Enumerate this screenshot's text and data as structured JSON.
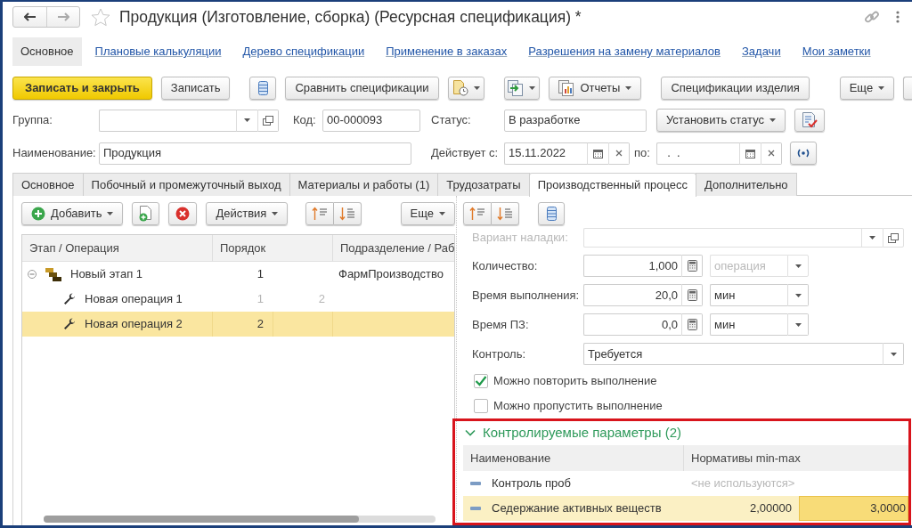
{
  "window": {
    "title": "Продукция (Изготовление, сборка) (Ресурсная спецификация) *"
  },
  "nav_panel": [
    {
      "label": "Основное",
      "selected": true
    },
    {
      "label": "Плановые калькуляции",
      "selected": false
    },
    {
      "label": "Дерево спецификации",
      "selected": false
    },
    {
      "label": "Применение в заказах",
      "selected": false
    },
    {
      "label": "Разрешения на замену материалов",
      "selected": false
    },
    {
      "label": "Задачи",
      "selected": false
    },
    {
      "label": "Мои заметки",
      "selected": false
    }
  ],
  "toolbar": [
    {
      "kind": "primary",
      "label": "Записать и закрыть"
    },
    {
      "kind": "button",
      "label": "Записать"
    },
    {
      "kind": "icon"
    },
    {
      "kind": "button",
      "label": "Сравнить спецификации"
    },
    {
      "kind": "icon-menu"
    },
    {
      "kind": "icon-menu"
    },
    {
      "kind": "icon-menu",
      "label": "Отчеты"
    },
    {
      "kind": "button",
      "label": "Спецификации изделия"
    },
    {
      "kind": "menu",
      "label": "Еще"
    },
    {
      "kind": "stub"
    }
  ],
  "group_field": {
    "label": "Группа:"
  },
  "code_field": {
    "label": "Код:",
    "value": "00-000093"
  },
  "status_field": {
    "label": "Статус:",
    "value": "В разработке"
  },
  "set_status_button": {
    "label": "Установить статус"
  },
  "name_field": {
    "label": "Наименование:",
    "value": "Продукция"
  },
  "valid_from": {
    "label": "Действует с:",
    "value": "15.11.2022"
  },
  "valid_to": {
    "label": "по:",
    "value": "  .  ."
  },
  "tabs": [
    {
      "label": "Основное",
      "selected": false
    },
    {
      "label": "Побочный и промежуточный выход",
      "selected": false
    },
    {
      "label": "Материалы и работы (1)",
      "selected": false
    },
    {
      "label": "Трудозатраты",
      "selected": false
    },
    {
      "label": "Производственный процесс",
      "selected": true
    },
    {
      "label": "Дополнительно",
      "selected": false
    }
  ],
  "stages_toolbar": [
    {
      "kind": "icon-menu",
      "label": "Добавить"
    },
    {
      "kind": "icon"
    },
    {
      "kind": "icon"
    },
    {
      "kind": "menu",
      "label": "Действия"
    },
    {
      "kind": "pair"
    },
    {
      "kind": "menu",
      "label": "Еще"
    }
  ],
  "stages_table": {
    "columns": [
      "Этап / Операция",
      "Порядок",
      "Подразделение / Раб"
    ],
    "rows": [
      {
        "kind": "stage",
        "name": "Новый этап 1",
        "order": "1",
        "department": "ФармПроизводство",
        "expanded": true,
        "selected": false,
        "dimmed": false,
        "children": [
          {
            "kind": "operation",
            "name": "Новая операция 1",
            "order": "1",
            "order_next": "2",
            "selected": false,
            "dimmed": true
          },
          {
            "kind": "operation",
            "name": "Новая операция 2",
            "order": "2",
            "selected": true,
            "dimmed": false
          }
        ]
      }
    ]
  },
  "operation_toolbar": [
    {
      "kind": "pair"
    },
    {
      "kind": "icon"
    }
  ],
  "operation_fields": [
    {
      "kind": "select",
      "label": "Вариант наладки:",
      "disabled": true
    },
    {
      "kind": "number",
      "label": "Количество:",
      "value": "1,000",
      "unit": "операция",
      "unit_disabled": true
    },
    {
      "kind": "number",
      "label": "Время выполнения:",
      "value": "20,0",
      "unit": "мин",
      "unit_disabled": false
    },
    {
      "kind": "number",
      "label": "Время ПЗ:",
      "value": "0,0",
      "unit": "мин",
      "unit_disabled": false
    },
    {
      "kind": "select",
      "label": "Контроль:",
      "value": "Требуется",
      "disabled": false
    }
  ],
  "checkboxes": [
    {
      "label": "Можно повторить выполнение",
      "checked": true
    },
    {
      "label": "Можно пропустить выполнение",
      "checked": false
    }
  ],
  "parameters_group": {
    "title": "Контролируемые параметры (2)",
    "expanded": true,
    "highlighted": true,
    "columns": [
      "Наименование",
      "Нормативы min-max"
    ],
    "rows": [
      {
        "kind": "unused",
        "name": "Контроль проб",
        "norms": "<не используются>",
        "selected": false
      },
      {
        "kind": "range",
        "name": "Седержание активных веществ",
        "min": "2,00000",
        "max": "3,0000",
        "selected": true
      }
    ]
  }
}
